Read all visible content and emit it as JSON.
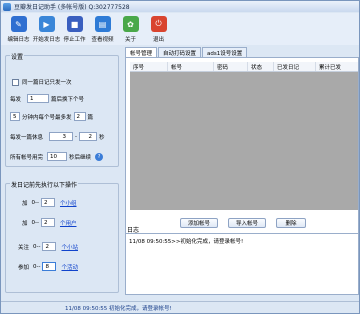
{
  "window": {
    "title": "豆瓣发日记助手 (多帐号版)   Q:302777528"
  },
  "toolbar": {
    "buttons": [
      {
        "label": "编辑日志",
        "icon": "edit-log-icon",
        "color": "#2f6fd1"
      },
      {
        "label": "开始发日志",
        "icon": "start-post-icon",
        "color": "#3a86d8"
      },
      {
        "label": "停止工作",
        "icon": "stop-work-icon",
        "color": "#3a5fbf"
      },
      {
        "label": "查看视频",
        "icon": "view-video-icon",
        "color": "#2e7bd6"
      },
      {
        "label": "关于",
        "icon": "about-icon",
        "color": "#4aa84a"
      },
      {
        "label": "退出",
        "icon": "exit-icon",
        "color": "#d9442f"
      }
    ]
  },
  "settings": {
    "title": "设置",
    "same_log_label": "同一篇日记只发一次",
    "every_label": "每发",
    "every_value": "1",
    "switch_label": "篇后换下个号",
    "minutes_value": "5",
    "minutes_label": "分钟内每个号最多发",
    "max_value": "2",
    "max_unit": "篇",
    "rest_label": "每发一篇休息",
    "rest_from": "3",
    "rest_sep": "-",
    "rest_to": "2",
    "rest_unit": "秒",
    "all_done_label": "所有帐号用完",
    "all_done_value": "10",
    "continue_label": "秒后继续",
    "help": "?"
  },
  "pre_actions": {
    "title": "发日记前先执行以下操作",
    "rows": [
      {
        "prefix": "加",
        "value": "2",
        "link": "个小组"
      },
      {
        "prefix": "加",
        "value": "2",
        "link": "个用户"
      },
      {
        "prefix": "关注",
        "value": "2",
        "link": "个小站"
      },
      {
        "prefix": "参加",
        "value": "8",
        "link": "个活动"
      }
    ],
    "dash": "0--"
  },
  "tabs": [
    {
      "label": "帐号管理",
      "active": true
    },
    {
      "label": "自动打码设置",
      "active": false
    },
    {
      "label": "ads1设号设置",
      "active": false
    }
  ],
  "table": {
    "columns": [
      "序号",
      "帐号",
      "密码",
      "状态",
      "已发日记",
      "累计已发"
    ]
  },
  "actions": {
    "add": "添加帐号",
    "import": "导入帐号",
    "delete": "删除"
  },
  "log": {
    "title": "日志",
    "lines": [
      "11/08 09:50:55>>初始化完成，请登录帐号!"
    ]
  },
  "status": {
    "text": "11/08 09:50:55  初始化完成，请登录帐号!"
  }
}
